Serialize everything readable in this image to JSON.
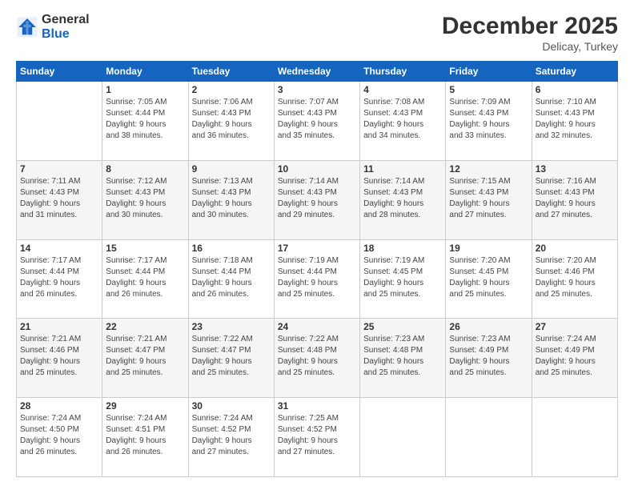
{
  "logo": {
    "line1": "General",
    "line2": "Blue"
  },
  "header": {
    "month": "December 2025",
    "location": "Delicay, Turkey"
  },
  "weekdays": [
    "Sunday",
    "Monday",
    "Tuesday",
    "Wednesday",
    "Thursday",
    "Friday",
    "Saturday"
  ],
  "weeks": [
    [
      {
        "day": "",
        "info": ""
      },
      {
        "day": "1",
        "info": "Sunrise: 7:05 AM\nSunset: 4:44 PM\nDaylight: 9 hours\nand 38 minutes."
      },
      {
        "day": "2",
        "info": "Sunrise: 7:06 AM\nSunset: 4:43 PM\nDaylight: 9 hours\nand 36 minutes."
      },
      {
        "day": "3",
        "info": "Sunrise: 7:07 AM\nSunset: 4:43 PM\nDaylight: 9 hours\nand 35 minutes."
      },
      {
        "day": "4",
        "info": "Sunrise: 7:08 AM\nSunset: 4:43 PM\nDaylight: 9 hours\nand 34 minutes."
      },
      {
        "day": "5",
        "info": "Sunrise: 7:09 AM\nSunset: 4:43 PM\nDaylight: 9 hours\nand 33 minutes."
      },
      {
        "day": "6",
        "info": "Sunrise: 7:10 AM\nSunset: 4:43 PM\nDaylight: 9 hours\nand 32 minutes."
      }
    ],
    [
      {
        "day": "7",
        "info": "Sunrise: 7:11 AM\nSunset: 4:43 PM\nDaylight: 9 hours\nand 31 minutes."
      },
      {
        "day": "8",
        "info": "Sunrise: 7:12 AM\nSunset: 4:43 PM\nDaylight: 9 hours\nand 30 minutes."
      },
      {
        "day": "9",
        "info": "Sunrise: 7:13 AM\nSunset: 4:43 PM\nDaylight: 9 hours\nand 30 minutes."
      },
      {
        "day": "10",
        "info": "Sunrise: 7:14 AM\nSunset: 4:43 PM\nDaylight: 9 hours\nand 29 minutes."
      },
      {
        "day": "11",
        "info": "Sunrise: 7:14 AM\nSunset: 4:43 PM\nDaylight: 9 hours\nand 28 minutes."
      },
      {
        "day": "12",
        "info": "Sunrise: 7:15 AM\nSunset: 4:43 PM\nDaylight: 9 hours\nand 27 minutes."
      },
      {
        "day": "13",
        "info": "Sunrise: 7:16 AM\nSunset: 4:43 PM\nDaylight: 9 hours\nand 27 minutes."
      }
    ],
    [
      {
        "day": "14",
        "info": "Sunrise: 7:17 AM\nSunset: 4:44 PM\nDaylight: 9 hours\nand 26 minutes."
      },
      {
        "day": "15",
        "info": "Sunrise: 7:17 AM\nSunset: 4:44 PM\nDaylight: 9 hours\nand 26 minutes."
      },
      {
        "day": "16",
        "info": "Sunrise: 7:18 AM\nSunset: 4:44 PM\nDaylight: 9 hours\nand 26 minutes."
      },
      {
        "day": "17",
        "info": "Sunrise: 7:19 AM\nSunset: 4:44 PM\nDaylight: 9 hours\nand 25 minutes."
      },
      {
        "day": "18",
        "info": "Sunrise: 7:19 AM\nSunset: 4:45 PM\nDaylight: 9 hours\nand 25 minutes."
      },
      {
        "day": "19",
        "info": "Sunrise: 7:20 AM\nSunset: 4:45 PM\nDaylight: 9 hours\nand 25 minutes."
      },
      {
        "day": "20",
        "info": "Sunrise: 7:20 AM\nSunset: 4:46 PM\nDaylight: 9 hours\nand 25 minutes."
      }
    ],
    [
      {
        "day": "21",
        "info": "Sunrise: 7:21 AM\nSunset: 4:46 PM\nDaylight: 9 hours\nand 25 minutes."
      },
      {
        "day": "22",
        "info": "Sunrise: 7:21 AM\nSunset: 4:47 PM\nDaylight: 9 hours\nand 25 minutes."
      },
      {
        "day": "23",
        "info": "Sunrise: 7:22 AM\nSunset: 4:47 PM\nDaylight: 9 hours\nand 25 minutes."
      },
      {
        "day": "24",
        "info": "Sunrise: 7:22 AM\nSunset: 4:48 PM\nDaylight: 9 hours\nand 25 minutes."
      },
      {
        "day": "25",
        "info": "Sunrise: 7:23 AM\nSunset: 4:48 PM\nDaylight: 9 hours\nand 25 minutes."
      },
      {
        "day": "26",
        "info": "Sunrise: 7:23 AM\nSunset: 4:49 PM\nDaylight: 9 hours\nand 25 minutes."
      },
      {
        "day": "27",
        "info": "Sunrise: 7:24 AM\nSunset: 4:49 PM\nDaylight: 9 hours\nand 25 minutes."
      }
    ],
    [
      {
        "day": "28",
        "info": "Sunrise: 7:24 AM\nSunset: 4:50 PM\nDaylight: 9 hours\nand 26 minutes."
      },
      {
        "day": "29",
        "info": "Sunrise: 7:24 AM\nSunset: 4:51 PM\nDaylight: 9 hours\nand 26 minutes."
      },
      {
        "day": "30",
        "info": "Sunrise: 7:24 AM\nSunset: 4:52 PM\nDaylight: 9 hours\nand 27 minutes."
      },
      {
        "day": "31",
        "info": "Sunrise: 7:25 AM\nSunset: 4:52 PM\nDaylight: 9 hours\nand 27 minutes."
      },
      {
        "day": "",
        "info": ""
      },
      {
        "day": "",
        "info": ""
      },
      {
        "day": "",
        "info": ""
      }
    ]
  ]
}
